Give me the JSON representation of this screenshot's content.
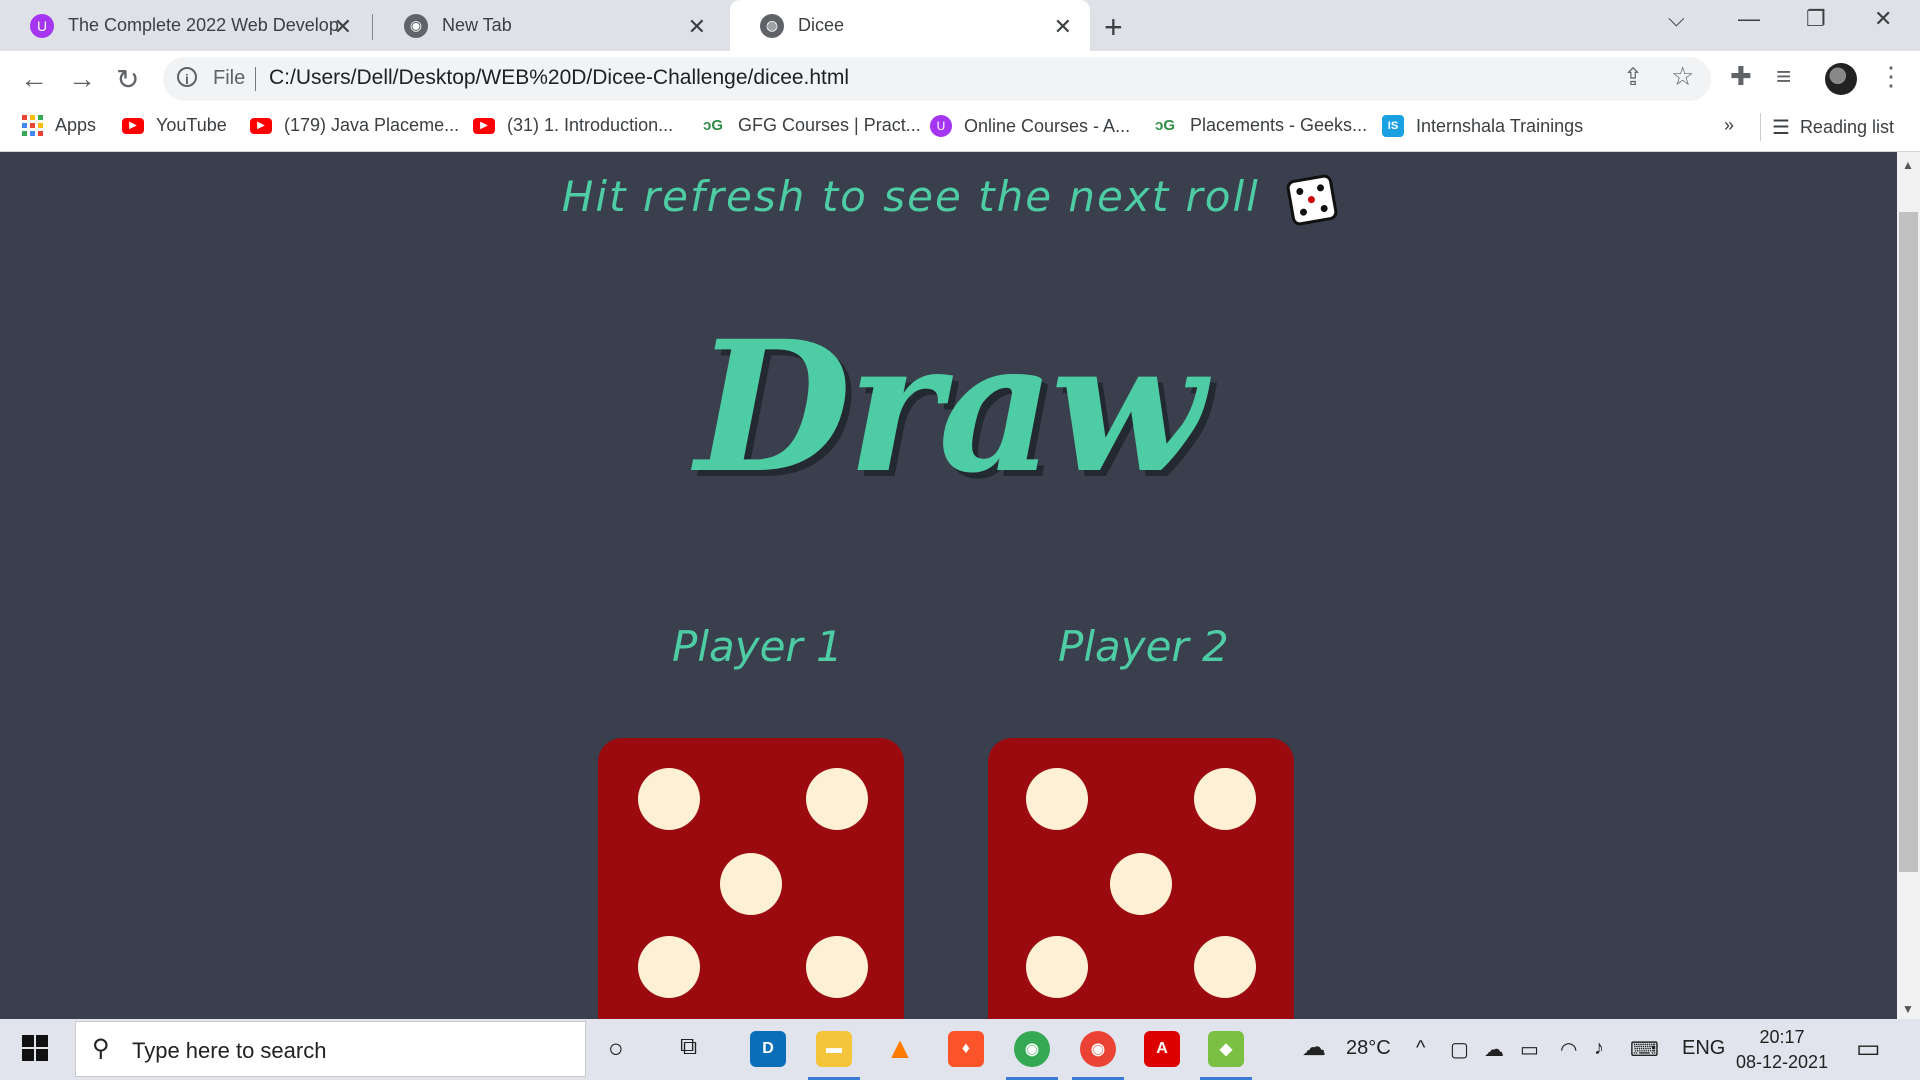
{
  "browser": {
    "tabs": [
      {
        "title": "The Complete 2022 Web Develop",
        "icon": "udemy-icon",
        "active": false
      },
      {
        "title": "New Tab",
        "icon": "chrome-icon",
        "active": false
      },
      {
        "title": "Dicee",
        "icon": "globe-icon",
        "active": true
      }
    ],
    "address": {
      "scheme_label": "File",
      "url": "C:/Users/Dell/Desktop/WEB%20D/Dicee-Challenge/dicee.html"
    },
    "bookmarks": [
      {
        "label": "Apps",
        "icon": "apps-grid-icon"
      },
      {
        "label": "YouTube",
        "icon": "youtube-icon"
      },
      {
        "label": "(179) Java Placeme...",
        "icon": "youtube-icon"
      },
      {
        "label": "(31) 1. Introduction...",
        "icon": "youtube-icon"
      },
      {
        "label": "GFG Courses | Pract...",
        "icon": "gfg-icon"
      },
      {
        "label": "Online Courses - A...",
        "icon": "udemy-icon"
      },
      {
        "label": "Placements - Geeks...",
        "icon": "gfg-icon"
      },
      {
        "label": "Internshala Trainings",
        "icon": "internshala-icon"
      }
    ],
    "bookmarks_overflow": "»",
    "reading_list": "Reading list"
  },
  "page": {
    "hint": "Hit refresh to see the next roll",
    "title": "Draw",
    "players": [
      {
        "label": "Player 1",
        "die_value": 5
      },
      {
        "label": "Player 2",
        "die_value": 5
      }
    ]
  },
  "taskbar": {
    "search_placeholder": "Type here to search",
    "weather": "28°C",
    "language": "ENG",
    "time": "20:17",
    "date": "08-12-2021"
  },
  "colors": {
    "accent": "#4ecca3",
    "background": "#393f4d",
    "die": "#9b0a0e",
    "pip": "#fdf0d5"
  }
}
